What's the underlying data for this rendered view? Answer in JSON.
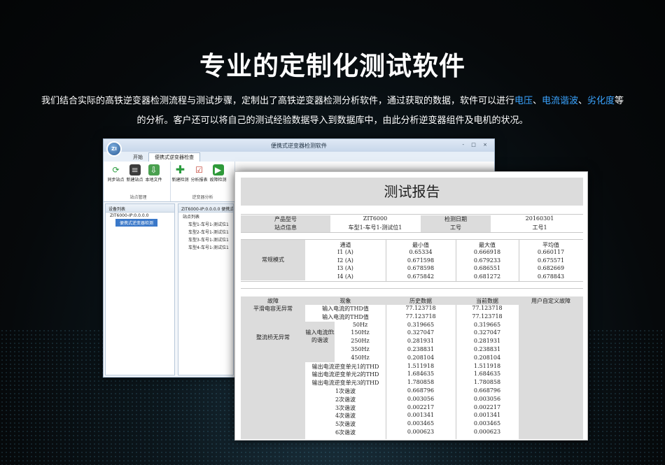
{
  "headline": "专业的定制化测试软件",
  "description": {
    "line1_part1": "我们结合实际的高铁逆变器检测流程与测试步骤，定制出了高铁逆变器检测分析软件，通过获取的数据，软件可以进行",
    "hl1": "电压",
    "sep1": "、",
    "hl2": "电流谐波",
    "sep2": "、",
    "hl3": "劣化度",
    "line1_end": "等",
    "line2": "的分析。客户还可以将自己的测试经验数据导入到数据库中，由此分析逆变器组件及电机的状况。"
  },
  "colors": {
    "accent": "#3aa4ff",
    "background": "#06090b"
  },
  "software": {
    "window_title": "便携式逆变器检测软件",
    "logo_text": "ZI",
    "tabs": [
      "开始",
      "便携式逆变器检查"
    ],
    "ribbon_group1": {
      "buttons": [
        "同步站点",
        "新建站点",
        "本地文件"
      ],
      "label": "站点管理"
    },
    "ribbon_group2": {
      "buttons": [
        "新建检测",
        "分析报表",
        "故障检测"
      ],
      "label": "逆变器分析"
    },
    "device_pane": {
      "header": "设备列表",
      "root": "ZIT6000-IP:0.0.0.0",
      "child": "便携式逆变器检测"
    },
    "site_pane": {
      "header": "ZIT6000-IP:0.0.0.0 便携式...",
      "list_label": "站点列表",
      "items": [
        "车型1-车号1-测试位1",
        "车型2-车号1-测试位1",
        "车型3-车号1-测试位1",
        "车型4-车号1-测试位1"
      ]
    },
    "window_controls": "- □ ×"
  },
  "report": {
    "title": "测试报告",
    "info": {
      "product_label": "产品型号",
      "product_value": "ZIT6000",
      "date_label": "检测日期",
      "date_value": "20160301",
      "site_label": "站点信息",
      "site_value": "车型1-车号1-测试位1",
      "worker_label": "工号",
      "worker_value": "工号1"
    },
    "normal": {
      "mode_label": "常规模式",
      "headers": [
        "通道",
        "最小值",
        "最大值",
        "平均值"
      ],
      "rows": [
        [
          "I1 (A)",
          "0.65334",
          "0.666918",
          "0.660117"
        ],
        [
          "I2 (A)",
          "0.671598",
          "0.679233",
          "0.675571"
        ],
        [
          "I3 (A)",
          "0.678598",
          "0.686551",
          "0.682669"
        ],
        [
          "I4 (A)",
          "0.675842",
          "0.681272",
          "0.678843"
        ]
      ]
    },
    "fault": {
      "headers": [
        "故障",
        "现象",
        "历史数据",
        "当前数据",
        "用户自定义故障"
      ],
      "cap_label": "平滑电容无异常",
      "bridge_label": "整流桥无异常",
      "harmonic_group": "输入电流fft的谐波",
      "rows_a": [
        [
          "输入电流的THD值",
          "77.123718",
          "77.123718"
        ],
        [
          "输入电流的THD值",
          "77.123718",
          "77.123718"
        ]
      ],
      "rows_b": [
        [
          "50Hz",
          "0.319665",
          "0.319665"
        ],
        [
          "150Hz",
          "0.327047",
          "0.327047"
        ],
        [
          "250Hz",
          "0.281931",
          "0.281931"
        ],
        [
          "350Hz",
          "0.238831",
          "0.238831"
        ],
        [
          "450Hz",
          "0.208104",
          "0.208104"
        ]
      ],
      "rows_c": [
        [
          "输出电流逆变单元1的THD",
          "1.511918",
          "1.511918"
        ],
        [
          "输出电流逆变单元2的THD",
          "1.684635",
          "1.684635"
        ],
        [
          "输出电流逆变单元3的THD",
          "1.780858",
          "1.780858"
        ],
        [
          "1次谐波",
          "0.668796",
          "0.668796"
        ],
        [
          "2次谐波",
          "0.003056",
          "0.003056"
        ],
        [
          "3次谐波",
          "0.002217",
          "0.002217"
        ],
        [
          "4次谐波",
          "0.001341",
          "0.001341"
        ],
        [
          "5次谐波",
          "0.003465",
          "0.003465"
        ],
        [
          "6次谐波",
          "0.000623",
          "0.000623"
        ]
      ]
    }
  }
}
